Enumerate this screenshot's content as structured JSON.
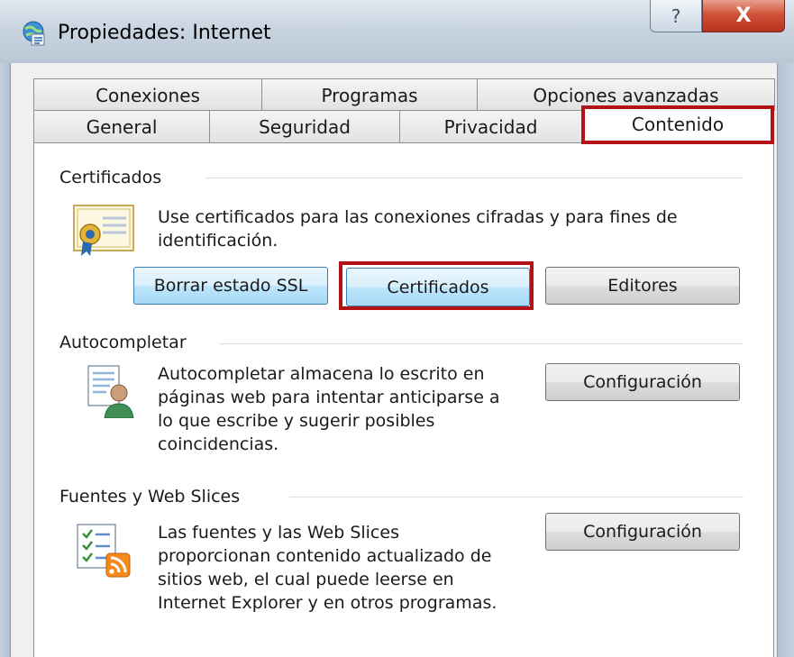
{
  "window": {
    "title": "Propiedades: Internet",
    "help_label": "?",
    "close_label": "X"
  },
  "tabs_row1": [
    "Conexiones",
    "Programas",
    "Opciones avanzadas"
  ],
  "tabs_row2": [
    "General",
    "Seguridad",
    "Privacidad",
    "Contenido"
  ],
  "active_tab": "Contenido",
  "certificados": {
    "label": "Certificados",
    "description_line1": "Use certificados para las conexiones cifradas y para fines de",
    "description_line2": "identificación.",
    "buttons": {
      "clear_ssl": "Borrar estado SSL",
      "certificates": "Certificados",
      "publishers": "Editores"
    },
    "icon": "certificate-icon"
  },
  "autocompletar": {
    "label": "Autocompletar",
    "description_lines": [
      "Autocompletar almacena lo escrito en",
      "páginas web para intentar anticiparse a",
      "lo que escribe y sugerir posibles",
      "coincidencias."
    ],
    "button": "Configuración",
    "icon": "autocomplete-icon"
  },
  "fuentes": {
    "label": "Fuentes y Web Slices",
    "description_lines": [
      "Las fuentes y las Web Slices",
      "proporcionan contenido actualizado de",
      "sitios web, el cual puede leerse en",
      "Internet Explorer y en otros programas."
    ],
    "button": "Configuración",
    "icon": "feeds-icon"
  },
  "colors": {
    "highlight": "#b31217",
    "focus_border": "#3c7fb1"
  }
}
